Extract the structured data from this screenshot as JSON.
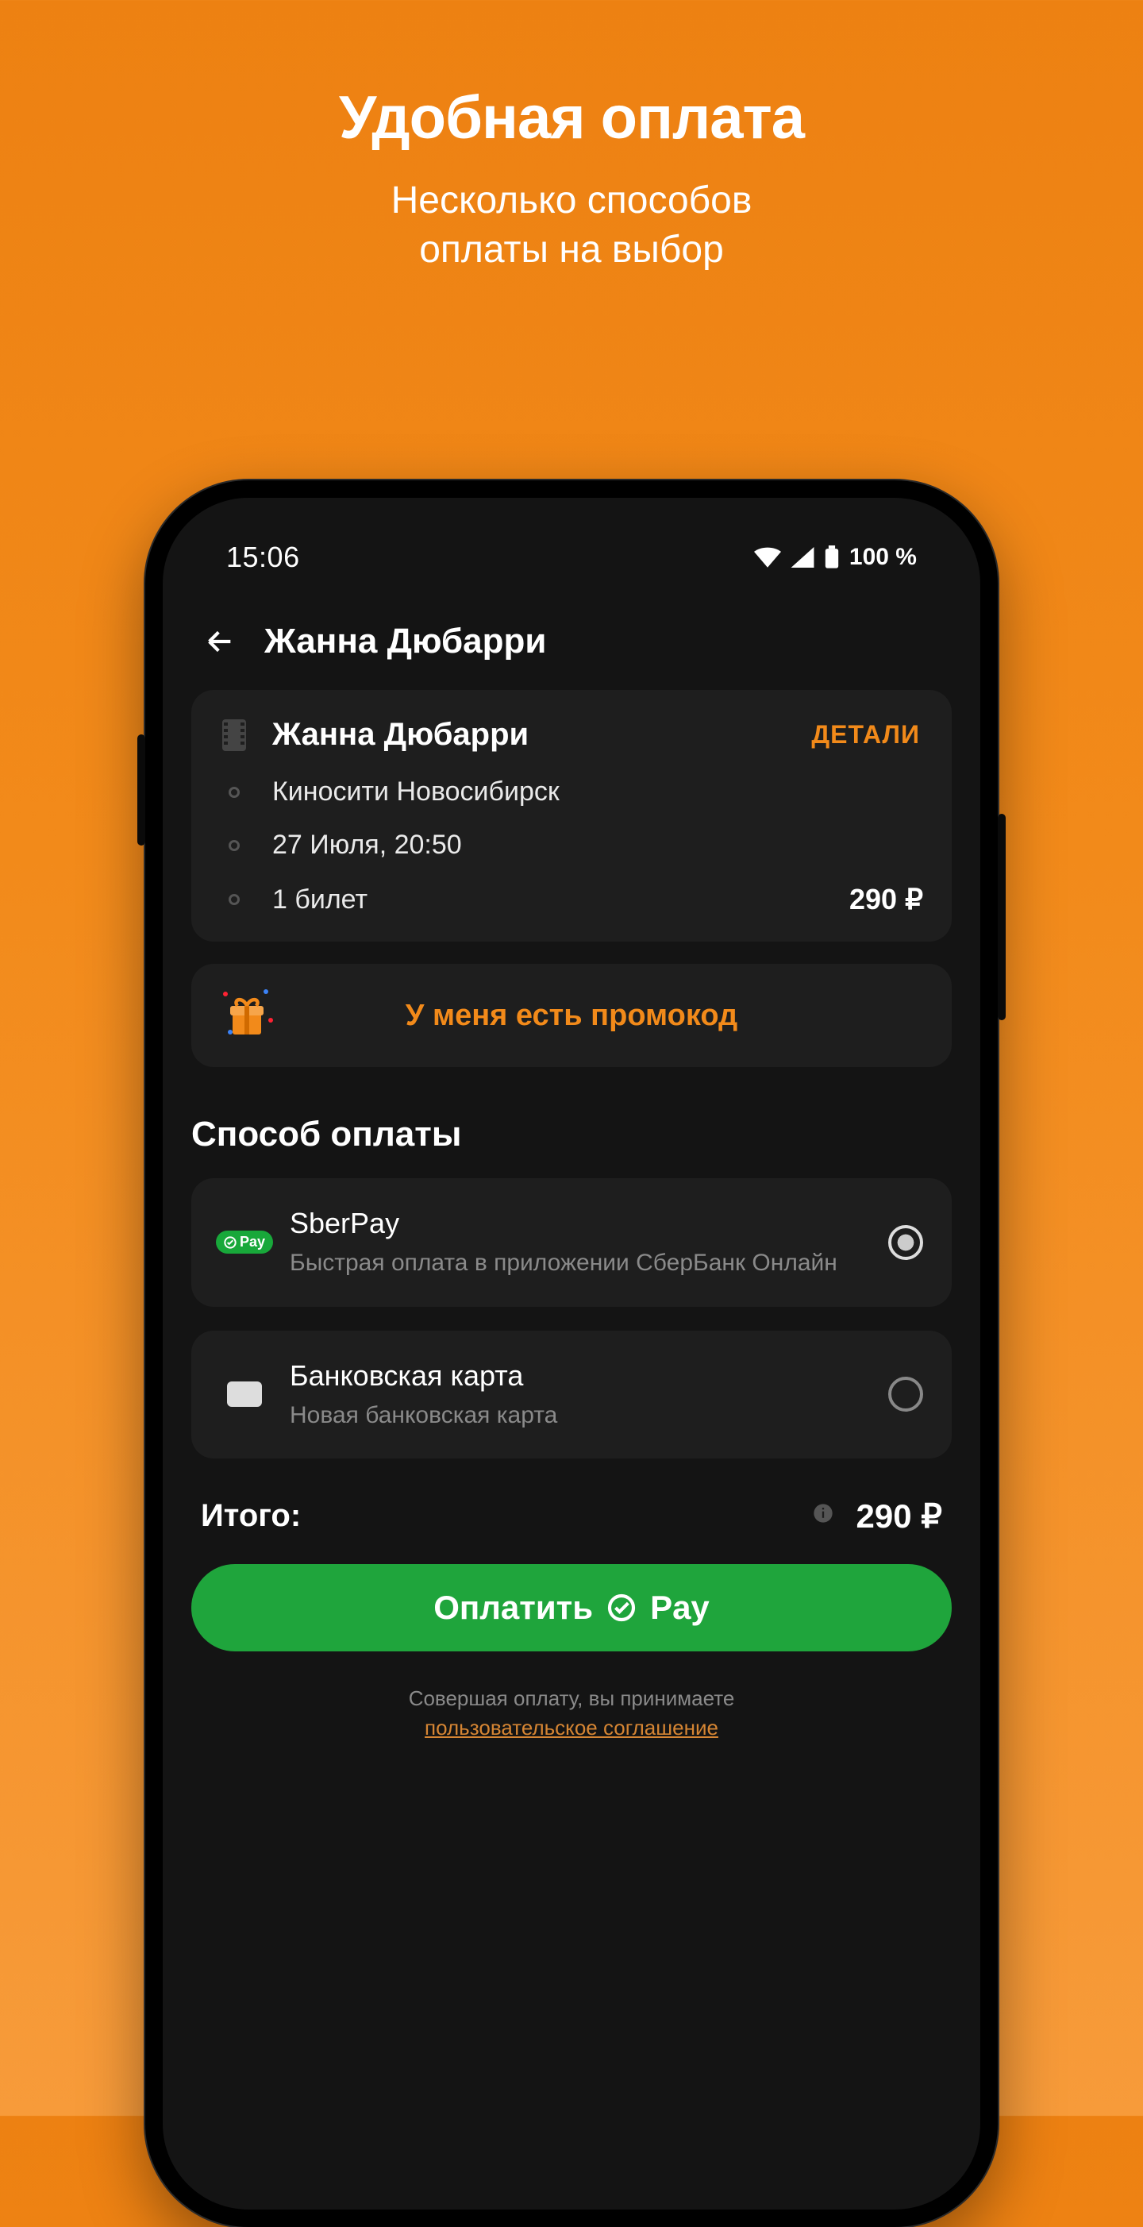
{
  "promo": {
    "title": "Удобная оплата",
    "subtitle1": "Несколько способов",
    "subtitle2": "оплаты на выбор"
  },
  "status": {
    "time": "15:06",
    "battery": "100 %"
  },
  "header": {
    "title": "Жанна Дюбарри"
  },
  "order": {
    "movie": "Жанна Дюбарри",
    "details_btn": "ДЕТАЛИ",
    "venue": "Киносити Новосибирск",
    "datetime": "27 Июля, 20:50",
    "tickets": "1 билет",
    "price": "290 ₽"
  },
  "promo_code": {
    "label": "У меня есть промокод"
  },
  "pay_section": {
    "title": "Способ оплаты"
  },
  "methods": [
    {
      "logo": "sber",
      "name": "SberPay",
      "sub": "Быстрая оплата в приложении СберБанк Онлайн",
      "selected": true
    },
    {
      "logo": "card",
      "name": "Банковская карта",
      "sub": "Новая банковская карта",
      "selected": false
    }
  ],
  "total": {
    "label": "Итого:",
    "price": "290 ₽"
  },
  "pay_button": {
    "prefix": "Оплатить",
    "suffix": "Pay"
  },
  "legal": {
    "line1": "Совершая оплату, вы принимаете",
    "line2": "пользовательское соглашение"
  }
}
